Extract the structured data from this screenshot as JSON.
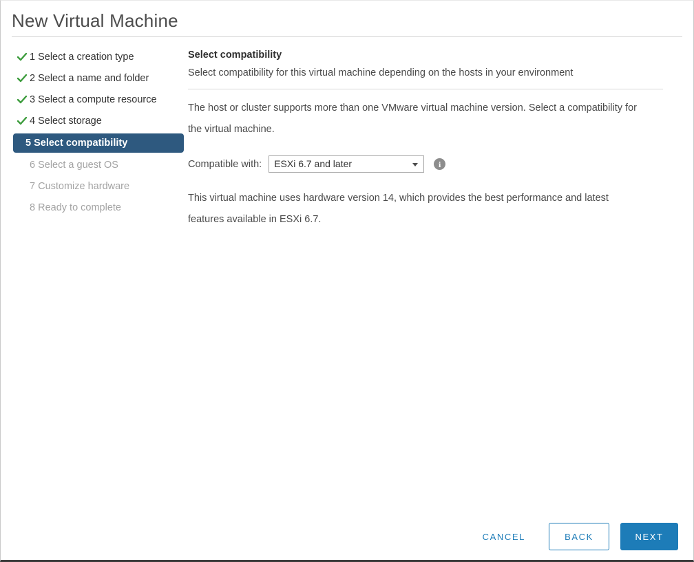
{
  "window": {
    "title": "New Virtual Machine"
  },
  "sidebar": {
    "steps": [
      {
        "number": "1",
        "label": "1 Select a creation type",
        "state": "done"
      },
      {
        "number": "2",
        "label": "2 Select a name and folder",
        "state": "done"
      },
      {
        "number": "3",
        "label": "3 Select a compute resource",
        "state": "done"
      },
      {
        "number": "4",
        "label": "4 Select storage",
        "state": "done"
      },
      {
        "number": "5",
        "label": "5 Select compatibility",
        "state": "active"
      },
      {
        "number": "6",
        "label": "6 Select a guest OS",
        "state": "pending"
      },
      {
        "number": "7",
        "label": "7 Customize hardware",
        "state": "pending"
      },
      {
        "number": "8",
        "label": "8 Ready to complete",
        "state": "pending"
      }
    ]
  },
  "main": {
    "heading": "Select compatibility",
    "subheading": "Select compatibility for this virtual machine depending on the hosts in your environment",
    "paragraph1": "The host or cluster supports more than one VMware virtual machine version. Select a compatibility for the virtual machine.",
    "compatible_label": "Compatible with:",
    "compatible_value": "ESXi 6.7 and later",
    "compatible_options": [
      "ESXi 6.7 and later"
    ],
    "info_glyph": "i",
    "paragraph2": "This virtual machine uses hardware version 14, which provides the best performance and latest features available in ESXi 6.7."
  },
  "footer": {
    "cancel_label": "CANCEL",
    "back_label": "BACK",
    "next_label": "NEXT"
  },
  "colors": {
    "active_step": "#2e597f",
    "check": "#3c9c3c",
    "accent": "#1d7cb8",
    "disabled_text": "#a3a3a3"
  }
}
